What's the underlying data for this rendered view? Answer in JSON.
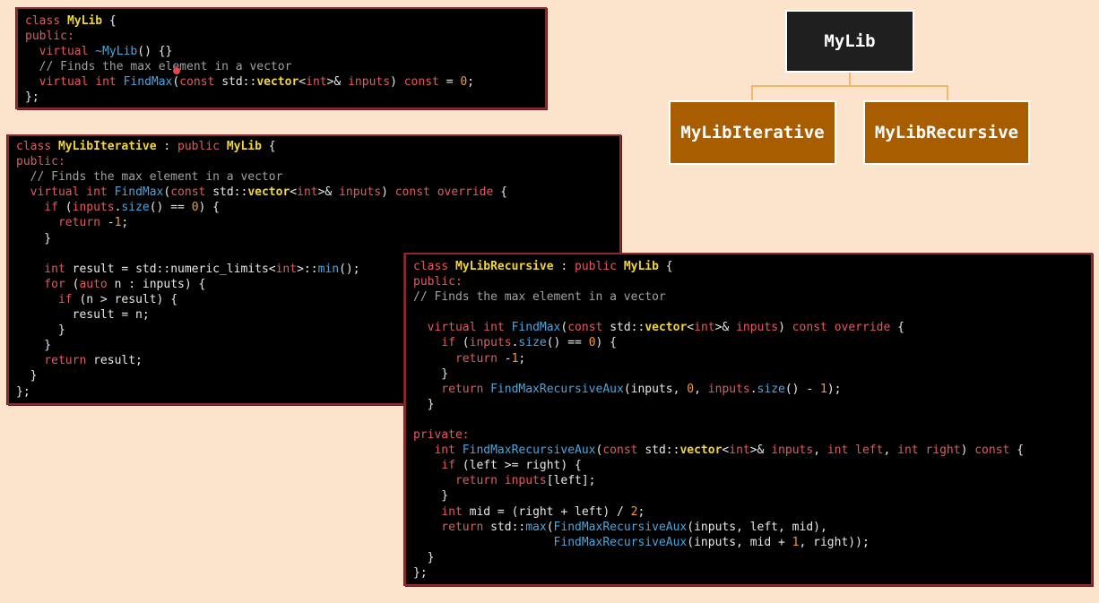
{
  "diagram": {
    "root": "MyLib",
    "children": [
      "MyLibIterative",
      "MyLibRecursive"
    ]
  },
  "colors": {
    "background": "#fbe3cc",
    "code_background": "#000000",
    "keyword": "#e15a60",
    "type": "#f0d63c",
    "function": "#4aa6e0",
    "number": "#f39a3c",
    "comment": "#a0a0a0",
    "root_node": "#1f1f1f",
    "child_node": "#a75d00",
    "connector": "#f5b66a"
  },
  "code_blocks": [
    {
      "id": "mylib",
      "lines": [
        [
          [
            "class ",
            "kw"
          ],
          [
            "MyLib",
            "ty"
          ],
          [
            " {",
            "op"
          ]
        ],
        [
          [
            "public:",
            "kw"
          ]
        ],
        [
          [
            "  virtual ",
            "kw"
          ],
          [
            "~MyLib",
            "fn"
          ],
          [
            "() {}",
            "op"
          ]
        ],
        [
          [
            "  // Finds the max element in a vector",
            "cm"
          ]
        ],
        [
          [
            "  virtual ",
            "kw"
          ],
          [
            "int ",
            "kw"
          ],
          [
            "FindMax",
            "fn"
          ],
          [
            "(",
            "op"
          ],
          [
            "const ",
            "kw"
          ],
          [
            "std::",
            "op"
          ],
          [
            "vector",
            "ty"
          ],
          [
            "<",
            "op"
          ],
          [
            "int",
            "kw"
          ],
          [
            ">& ",
            "op"
          ],
          [
            "inputs",
            "kw"
          ],
          [
            ") ",
            "op"
          ],
          [
            "const ",
            "kw"
          ],
          [
            "= ",
            "op"
          ],
          [
            "0",
            "num"
          ],
          [
            ";",
            "op"
          ]
        ],
        [
          [
            "};",
            "op"
          ]
        ]
      ]
    },
    {
      "id": "iterative",
      "lines": [
        [
          [
            "class ",
            "kw"
          ],
          [
            "MyLibIterative",
            "ty"
          ],
          [
            " : ",
            "op"
          ],
          [
            "public ",
            "kw"
          ],
          [
            "MyLib",
            "ty"
          ],
          [
            " {",
            "op"
          ]
        ],
        [
          [
            "public:",
            "kw"
          ]
        ],
        [
          [
            "  // Finds the max element in a vector",
            "cm"
          ]
        ],
        [
          [
            "  virtual ",
            "kw"
          ],
          [
            "int ",
            "kw"
          ],
          [
            "FindMax",
            "fn"
          ],
          [
            "(",
            "op"
          ],
          [
            "const ",
            "kw"
          ],
          [
            "std::",
            "op"
          ],
          [
            "vector",
            "ty"
          ],
          [
            "<",
            "op"
          ],
          [
            "int",
            "kw"
          ],
          [
            ">& ",
            "op"
          ],
          [
            "inputs",
            "kw"
          ],
          [
            ") ",
            "op"
          ],
          [
            "const ",
            "kw"
          ],
          [
            "override",
            "kw"
          ],
          [
            " {",
            "op"
          ]
        ],
        [
          [
            "    if ",
            "kw"
          ],
          [
            "(",
            "op"
          ],
          [
            "inputs",
            "kw"
          ],
          [
            ".",
            "op"
          ],
          [
            "size",
            "fn"
          ],
          [
            "() == ",
            "op"
          ],
          [
            "0",
            "num"
          ],
          [
            ") {",
            "op"
          ]
        ],
        [
          [
            "      return ",
            "kw"
          ],
          [
            "-",
            "op"
          ],
          [
            "1",
            "num"
          ],
          [
            ";",
            "op"
          ]
        ],
        [
          [
            "    }",
            "op"
          ]
        ],
        [
          [
            "",
            "op"
          ]
        ],
        [
          [
            "    int ",
            "kw"
          ],
          [
            "result = std::numeric_limits<",
            "op"
          ],
          [
            "int",
            "kw"
          ],
          [
            ">::",
            "op"
          ],
          [
            "min",
            "fn"
          ],
          [
            "();",
            "op"
          ]
        ],
        [
          [
            "    for ",
            "kw"
          ],
          [
            "(",
            "op"
          ],
          [
            "auto ",
            "kw"
          ],
          [
            "n : inputs) {",
            "op"
          ]
        ],
        [
          [
            "      if ",
            "kw"
          ],
          [
            "(n > result) {",
            "op"
          ]
        ],
        [
          [
            "        result = n;",
            "op"
          ]
        ],
        [
          [
            "      }",
            "op"
          ]
        ],
        [
          [
            "    }",
            "op"
          ]
        ],
        [
          [
            "    return ",
            "kw"
          ],
          [
            "result;",
            "op"
          ]
        ],
        [
          [
            "  }",
            "op"
          ]
        ],
        [
          [
            "};",
            "op"
          ]
        ]
      ]
    },
    {
      "id": "recursive",
      "lines": [
        [
          [
            "class ",
            "kw"
          ],
          [
            "MyLibRecursive",
            "ty"
          ],
          [
            " : ",
            "op"
          ],
          [
            "public ",
            "kw"
          ],
          [
            "MyLib",
            "ty"
          ],
          [
            " {",
            "op"
          ]
        ],
        [
          [
            "public:",
            "kw"
          ]
        ],
        [
          [
            "// Finds the max element in a vector",
            "cm"
          ]
        ],
        [
          [
            "",
            "op"
          ]
        ],
        [
          [
            "  virtual ",
            "kw"
          ],
          [
            "int ",
            "kw"
          ],
          [
            "FindMax",
            "fn"
          ],
          [
            "(",
            "op"
          ],
          [
            "const ",
            "kw"
          ],
          [
            "std::",
            "op"
          ],
          [
            "vector",
            "ty"
          ],
          [
            "<",
            "op"
          ],
          [
            "int",
            "kw"
          ],
          [
            ">& ",
            "op"
          ],
          [
            "inputs",
            "kw"
          ],
          [
            ") ",
            "op"
          ],
          [
            "const ",
            "kw"
          ],
          [
            "override",
            "kw"
          ],
          [
            " {",
            "op"
          ]
        ],
        [
          [
            "    if ",
            "kw"
          ],
          [
            "(",
            "op"
          ],
          [
            "inputs",
            "kw"
          ],
          [
            ".",
            "op"
          ],
          [
            "size",
            "fn"
          ],
          [
            "() == ",
            "op"
          ],
          [
            "0",
            "num"
          ],
          [
            ") {",
            "op"
          ]
        ],
        [
          [
            "      return ",
            "kw"
          ],
          [
            "-",
            "op"
          ],
          [
            "1",
            "num"
          ],
          [
            ";",
            "op"
          ]
        ],
        [
          [
            "    }",
            "op"
          ]
        ],
        [
          [
            "    return ",
            "kw"
          ],
          [
            "FindMaxRecursiveAux",
            "fn"
          ],
          [
            "(inputs, ",
            "op"
          ],
          [
            "0",
            "num"
          ],
          [
            ", ",
            "op"
          ],
          [
            "inputs",
            "kw"
          ],
          [
            ".",
            "op"
          ],
          [
            "size",
            "fn"
          ],
          [
            "() - ",
            "op"
          ],
          [
            "1",
            "num"
          ],
          [
            ");",
            "op"
          ]
        ],
        [
          [
            "  }",
            "op"
          ]
        ],
        [
          [
            "",
            "op"
          ]
        ],
        [
          [
            "private:",
            "kw"
          ]
        ],
        [
          [
            "   int ",
            "kw"
          ],
          [
            "FindMaxRecursiveAux",
            "fn"
          ],
          [
            "(",
            "op"
          ],
          [
            "const ",
            "kw"
          ],
          [
            "std::",
            "op"
          ],
          [
            "vector",
            "ty"
          ],
          [
            "<",
            "op"
          ],
          [
            "int",
            "kw"
          ],
          [
            ">& ",
            "op"
          ],
          [
            "inputs",
            "kw"
          ],
          [
            ", ",
            "op"
          ],
          [
            "int ",
            "kw"
          ],
          [
            "left",
            "kw"
          ],
          [
            ", ",
            "op"
          ],
          [
            "int ",
            "kw"
          ],
          [
            "right",
            "kw"
          ],
          [
            ") ",
            "op"
          ],
          [
            "const ",
            "kw"
          ],
          [
            "{",
            "op"
          ]
        ],
        [
          [
            "    if ",
            "kw"
          ],
          [
            "(left >= right) {",
            "op"
          ]
        ],
        [
          [
            "      return ",
            "kw"
          ],
          [
            "inputs",
            "kw"
          ],
          [
            "[left];",
            "op"
          ]
        ],
        [
          [
            "    }",
            "op"
          ]
        ],
        [
          [
            "    int ",
            "kw"
          ],
          [
            "mid = (right + left) / ",
            "op"
          ],
          [
            "2",
            "num"
          ],
          [
            ";",
            "op"
          ]
        ],
        [
          [
            "    return ",
            "kw"
          ],
          [
            "std::",
            "op"
          ],
          [
            "max",
            "fn"
          ],
          [
            "(",
            "op"
          ],
          [
            "FindMaxRecursiveAux",
            "fn"
          ],
          [
            "(inputs, left, mid),",
            "op"
          ]
        ],
        [
          [
            "                    ",
            "op"
          ],
          [
            "FindMaxRecursiveAux",
            "fn"
          ],
          [
            "(inputs, mid + ",
            "op"
          ],
          [
            "1",
            "num"
          ],
          [
            ", right));",
            "op"
          ]
        ],
        [
          [
            "  }",
            "op"
          ]
        ],
        [
          [
            "};",
            "op"
          ]
        ]
      ]
    }
  ]
}
